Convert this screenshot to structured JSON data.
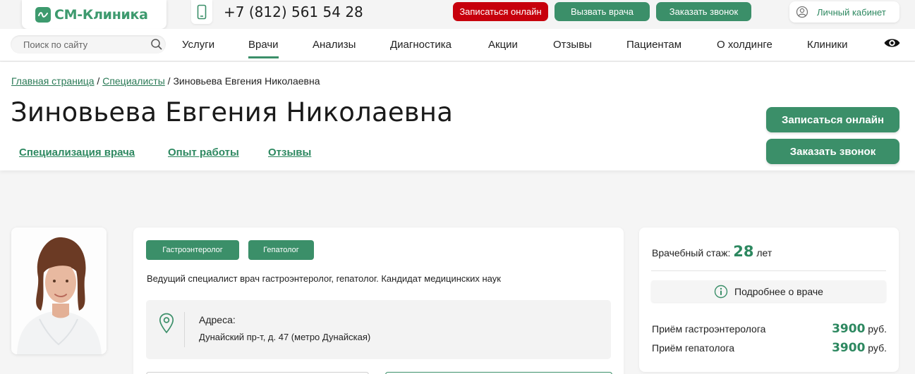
{
  "top": {
    "logo": "СМ-Клиника",
    "phone": "+7 (812) 561 54 28",
    "btn_online": "Записаться онлайн",
    "btn_doctor": "Вызвать врача",
    "btn_call": "Заказать звонок",
    "cabinet": "Личный кабинет"
  },
  "nav": {
    "search_placeholder": "Поиск по сайту",
    "items": [
      "Услуги",
      "Врачи",
      "Анализы",
      "Диагностика",
      "Акции",
      "Отзывы",
      "Пациентам",
      "О холдинге",
      "Клиники"
    ],
    "active": "Врачи"
  },
  "breadcrumb": {
    "home": "Главная страница",
    "specialists": "Специалисты",
    "current": "Зиновьева Евгения Николаевна",
    "separator": " / "
  },
  "doctor": {
    "name": "Зиновьева Евгения Николаевна",
    "tabs": [
      "Специализация врача",
      "Опыт работы",
      "Отзывы"
    ],
    "btn_online": "Записаться онлайн",
    "btn_call": "Заказать звонок",
    "tags": [
      "Гастроэнтеролог",
      "Гепатолог"
    ],
    "description": "Ведущий специалист врач гастроэнтеролог, гепатолог. Кандидат медицинских наук",
    "address_label": "Адреса:",
    "address": "Дунайский пр-т, д. 47 (метро Дунайская)"
  },
  "sidebar": {
    "experience_label": "Врачебный стаж:",
    "experience_value": "28",
    "experience_unit": "лет",
    "more_button": "Подробнее о враче",
    "prices": [
      {
        "label": "Приём гастроэнтеролога",
        "amount": "3900",
        "currency": "руб."
      },
      {
        "label": "Приём гепатолога",
        "amount": "3900",
        "currency": "руб."
      }
    ]
  },
  "colors": {
    "brand_green": "#3b8f69",
    "accent_red": "#c7000c"
  }
}
